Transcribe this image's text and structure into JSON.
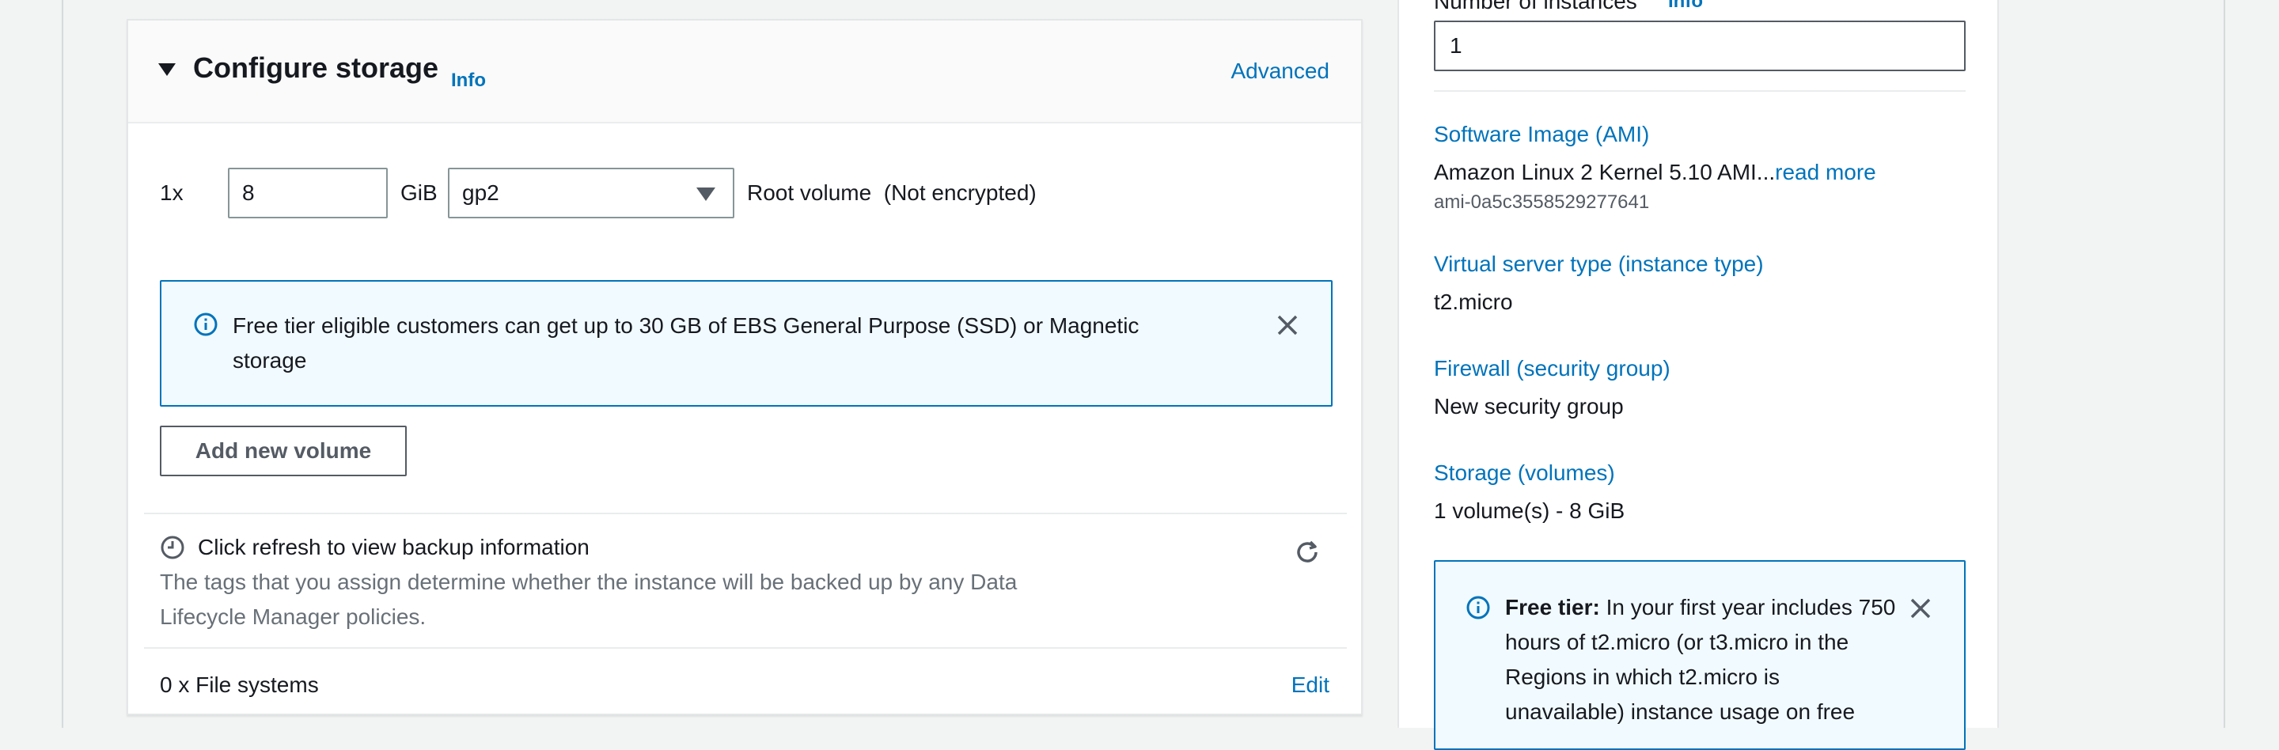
{
  "storage": {
    "title": "Configure storage",
    "info_label": "Info",
    "advanced_label": "Advanced",
    "volume": {
      "multiplier": "1x",
      "size_value": "8",
      "unit": "GiB",
      "type_value": "gp2",
      "description": "Root volume  (Not encrypted)"
    },
    "alert": {
      "text": "Free tier eligible customers can get up to 30 GB of EBS General Purpose (SSD) or Magnetic storage"
    },
    "add_volume_label": "Add new volume",
    "backup": {
      "title": "Click refresh to view backup information",
      "description": "The tags that you assign determine whether the instance will be backed up by any Data Lifecycle Manager policies."
    },
    "file_systems": {
      "text": "0 x File systems",
      "edit_label": "Edit"
    }
  },
  "summary": {
    "instances_label": "Number of instances",
    "instances_info": "Info",
    "instances_value": "1",
    "ami_label": "Software Image (AMI)",
    "ami_value": "Amazon Linux 2 Kernel 5.10 AMI...",
    "ami_read_more": "read more",
    "ami_id": "ami-0a5c3558529277641",
    "instance_type_label": "Virtual server type (instance type)",
    "instance_type_value": "t2.micro",
    "firewall_label": "Firewall (security group)",
    "firewall_value": "New security group",
    "storage_label": "Storage (volumes)",
    "storage_value": "1 volume(s) - 8 GiB",
    "free_tier": {
      "bold": "Free tier:",
      "text": " In your first year includes 750 hours of t2.micro (or t3.micro in the Regions in which t2.micro is unavailable) instance usage on free"
    }
  },
  "colors": {
    "link": "#0073bb",
    "alert_bg": "#f1faff",
    "border": "#879596"
  }
}
